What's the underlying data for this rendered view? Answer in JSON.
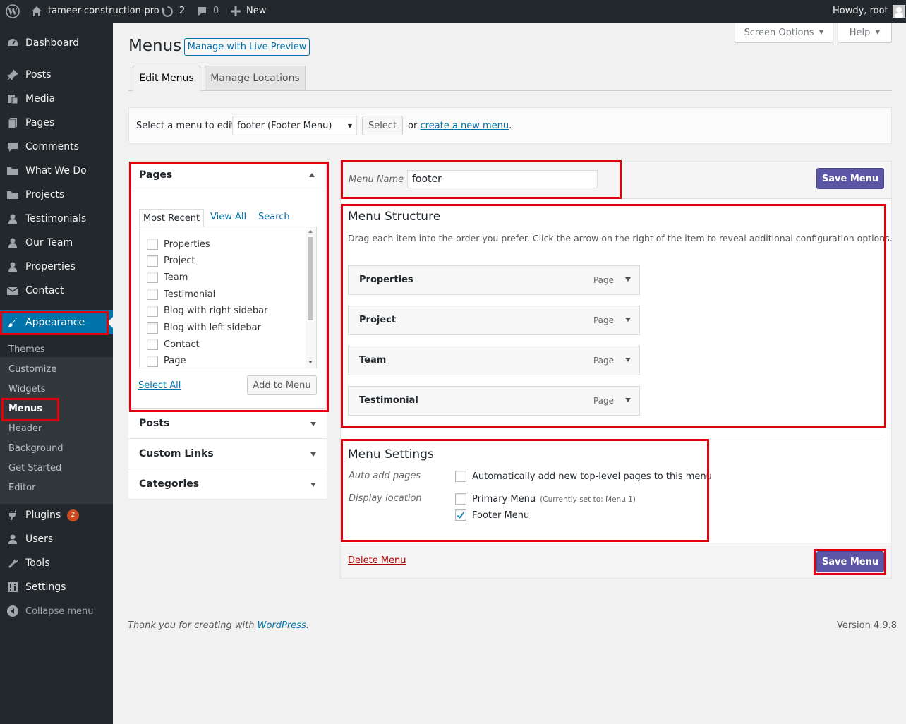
{
  "adminbar": {
    "site_name": "tameer-construction-pro",
    "updates_count": "2",
    "comments_count": "0",
    "new_label": "New",
    "howdy": "Howdy, root"
  },
  "sidebar": {
    "items": [
      {
        "label": "Dashboard",
        "icon": "dashboard-icon"
      },
      {
        "label": "Posts",
        "icon": "pin-icon"
      },
      {
        "label": "Media",
        "icon": "media-icon"
      },
      {
        "label": "Pages",
        "icon": "page-icon"
      },
      {
        "label": "Comments",
        "icon": "comment-icon"
      },
      {
        "label": "What We Do",
        "icon": "folder-icon"
      },
      {
        "label": "Projects",
        "icon": "folder-icon"
      },
      {
        "label": "Testimonials",
        "icon": "user-icon"
      },
      {
        "label": "Our Team",
        "icon": "user-icon"
      },
      {
        "label": "Properties",
        "icon": "user-icon"
      },
      {
        "label": "Contact",
        "icon": "email-icon"
      },
      {
        "label": "Appearance",
        "icon": "brush-icon"
      },
      {
        "label": "Plugins",
        "icon": "plugin-icon",
        "badge": "2"
      },
      {
        "label": "Users",
        "icon": "user-icon"
      },
      {
        "label": "Tools",
        "icon": "wrench-icon"
      },
      {
        "label": "Settings",
        "icon": "settings-icon"
      },
      {
        "label": "Collapse menu",
        "icon": "collapse-icon"
      }
    ],
    "submenu": [
      "Themes",
      "Customize",
      "Widgets",
      "Menus",
      "Header",
      "Background",
      "Get Started",
      "Editor"
    ]
  },
  "header": {
    "screen_options": "Screen Options",
    "help": "Help",
    "title": "Menus",
    "live_preview": "Manage with Live Preview",
    "tabs": [
      "Edit Menus",
      "Manage Locations"
    ]
  },
  "select_bar": {
    "label": "Select a menu to edit:",
    "selected": "footer (Footer Menu)",
    "select_button": "Select",
    "or_text": "or",
    "create_link": "create a new menu",
    "period": "."
  },
  "left_panel": {
    "pages_title": "Pages",
    "tabs": [
      "Most Recent",
      "View All",
      "Search"
    ],
    "pages": [
      "Properties",
      "Project",
      "Team",
      "Testimonial",
      "Blog with right sidebar",
      "Blog with left sidebar",
      "Contact",
      "Page"
    ],
    "select_all": "Select All",
    "add_to_menu": "Add to Menu",
    "sections": [
      "Posts",
      "Custom Links",
      "Categories"
    ]
  },
  "menu_edit": {
    "menu_name_label": "Menu Name",
    "menu_name_value": "footer",
    "save_menu": "Save Menu",
    "structure_title": "Menu Structure",
    "structure_desc": "Drag each item into the order you prefer. Click the arrow on the right of the item to reveal additional configuration options.",
    "items": [
      {
        "title": "Properties",
        "type": "Page"
      },
      {
        "title": "Project",
        "type": "Page"
      },
      {
        "title": "Team",
        "type": "Page"
      },
      {
        "title": "Testimonial",
        "type": "Page"
      }
    ],
    "settings_title": "Menu Settings",
    "auto_add_label": "Auto add pages",
    "auto_add_text": "Automatically add new top-level pages to this menu",
    "display_location_label": "Display location",
    "primary_menu": "Primary Menu",
    "primary_menu_note": "(Currently set to: Menu 1)",
    "footer_menu": "Footer Menu",
    "delete_menu": "Delete Menu"
  },
  "footer": {
    "thanks": "Thank you for creating with",
    "wordpress_link": "WordPress",
    "period": ".",
    "version": "Version 4.9.8"
  }
}
